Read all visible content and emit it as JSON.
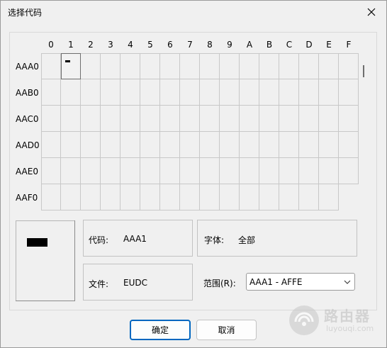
{
  "window": {
    "title": "选择代码"
  },
  "grid": {
    "columns": [
      "0",
      "1",
      "2",
      "3",
      "4",
      "5",
      "6",
      "7",
      "8",
      "9",
      "A",
      "B",
      "C",
      "D",
      "E",
      "F"
    ],
    "rows": [
      "AAA0",
      "AAB0",
      "AAC0",
      "AAD0",
      "AAE0",
      "AAF0"
    ],
    "selected": {
      "row": "AAA0",
      "column": "1"
    }
  },
  "info": {
    "code_label": "代码:",
    "code_value": "AAA1",
    "font_label": "字体:",
    "font_value": "全部",
    "file_label": "文件:",
    "file_value": "EUDC",
    "range_label": "范围(R):",
    "range_value": "AAA1 - AFFE"
  },
  "buttons": {
    "ok_label": "确定",
    "cancel_label": "取消"
  },
  "watermark": {
    "brand_cn": "路由器",
    "brand_url": "luyouqi.com"
  },
  "colors": {
    "window_bg": "#f0f0f0",
    "grid_line": "#c8c8c8",
    "accent": "#0067c0"
  },
  "icons": {
    "close": "close-icon",
    "dropdown": "chevron-down-icon",
    "watermark_logo": "router-logo-icon"
  }
}
